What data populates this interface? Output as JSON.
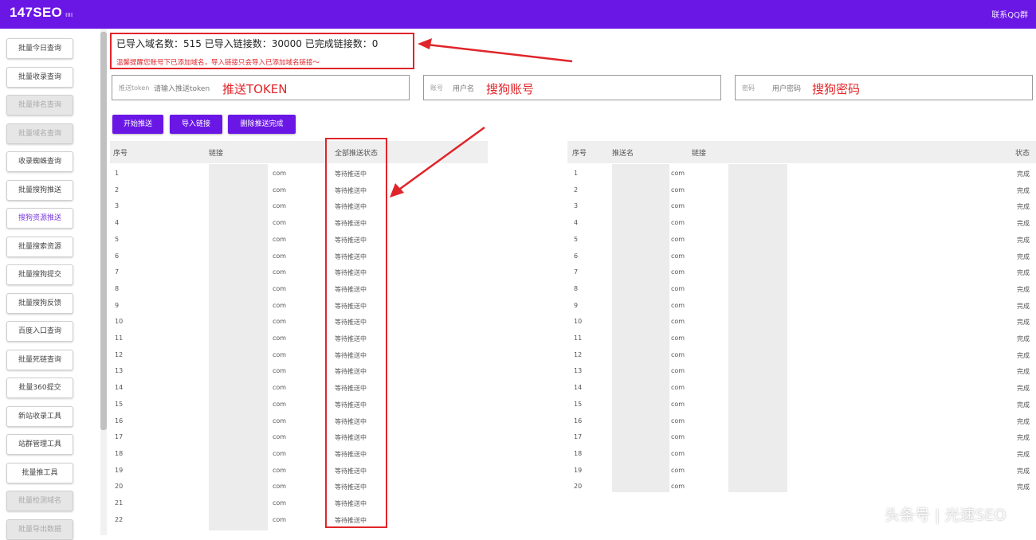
{
  "header": {
    "brand": "147SEO",
    "brand_sub": "ιιιι",
    "contact": "联系QQ群"
  },
  "sidebar": {
    "items": [
      {
        "label": "批量今日查询",
        "state": "normal"
      },
      {
        "label": "批量收录查询",
        "state": "normal"
      },
      {
        "label": "批量排名查询",
        "state": "disabled"
      },
      {
        "label": "批量域名查询",
        "state": "disabled"
      },
      {
        "label": "收录蜘蛛查询",
        "state": "normal"
      },
      {
        "label": "批量搜狗推送",
        "state": "normal"
      },
      {
        "label": "搜狗资源推送",
        "state": "active"
      },
      {
        "label": "批量搜索资源",
        "state": "normal"
      },
      {
        "label": "批量搜狗提交",
        "state": "normal"
      },
      {
        "label": "批量搜狗反馈",
        "state": "normal"
      },
      {
        "label": "百度入口查询",
        "state": "normal"
      },
      {
        "label": "批量死链查询",
        "state": "normal"
      },
      {
        "label": "批量360提交",
        "state": "normal"
      },
      {
        "label": "新站收录工具",
        "state": "normal"
      },
      {
        "label": "站群管理工具",
        "state": "normal"
      },
      {
        "label": "批量推工具",
        "state": "normal"
      },
      {
        "label": "批量检测域名",
        "state": "disabled"
      },
      {
        "label": "批量导出数据",
        "state": "disabled"
      }
    ]
  },
  "stats": {
    "line": "已导入域名数：515 已导入链接数：30000 已完成链接数：0",
    "warning": "温馨提醒您账号下已添加域名，导入链接只会导入已添加域名链接～"
  },
  "fields": [
    {
      "label": "推送token",
      "placeholder": "请输入推送token",
      "annotation": "推送TOKEN"
    },
    {
      "label": "账号",
      "placeholder": "用户名",
      "annotation": "搜狗账号"
    },
    {
      "label": "密码",
      "placeholder": "用户密码",
      "annotation": "搜狗密码"
    }
  ],
  "buttons": [
    "开始推送",
    "导入链接",
    "删除推送完成"
  ],
  "left_table": {
    "headers": [
      "序号",
      "链接",
      "全部推送状态"
    ],
    "rows": [
      {
        "idx": "1",
        "link": "com",
        "status": "等待推送中"
      },
      {
        "idx": "2",
        "link": "com",
        "status": "等待推送中"
      },
      {
        "idx": "3",
        "link": "com",
        "status": "等待推送中"
      },
      {
        "idx": "4",
        "link": "com",
        "status": "等待推送中"
      },
      {
        "idx": "5",
        "link": "com",
        "status": "等待推送中"
      },
      {
        "idx": "6",
        "link": "com",
        "status": "等待推送中"
      },
      {
        "idx": "7",
        "link": "com",
        "status": "等待推送中"
      },
      {
        "idx": "8",
        "link": "com",
        "status": "等待推送中"
      },
      {
        "idx": "9",
        "link": "com",
        "status": "等待推送中"
      },
      {
        "idx": "10",
        "link": "com",
        "status": "等待推送中"
      },
      {
        "idx": "11",
        "link": "com",
        "status": "等待推送中"
      },
      {
        "idx": "12",
        "link": "com",
        "status": "等待推送中"
      },
      {
        "idx": "13",
        "link": "com",
        "status": "等待推送中"
      },
      {
        "idx": "14",
        "link": "com",
        "status": "等待推送中"
      },
      {
        "idx": "15",
        "link": "com",
        "status": "等待推送中"
      },
      {
        "idx": "16",
        "link": "com",
        "status": "等待推送中"
      },
      {
        "idx": "17",
        "link": "com",
        "status": "等待推送中"
      },
      {
        "idx": "18",
        "link": "com",
        "status": "等待推送中"
      },
      {
        "idx": "19",
        "link": "com",
        "status": "等待推送中"
      },
      {
        "idx": "20",
        "link": "com",
        "status": "等待推送中"
      },
      {
        "idx": "21",
        "link": "com",
        "status": "等待推送中"
      },
      {
        "idx": "22",
        "link": "com",
        "status": "等待推送中"
      }
    ]
  },
  "right_table": {
    "headers": [
      "序号",
      "推送名",
      "链接",
      "状态"
    ],
    "rows": [
      {
        "idx": "1",
        "name": "",
        "link": "com",
        "status": "完成"
      },
      {
        "idx": "2",
        "name": "",
        "link": "com",
        "status": "完成"
      },
      {
        "idx": "3",
        "name": "",
        "link": "com",
        "status": "完成"
      },
      {
        "idx": "4",
        "name": "",
        "link": "com",
        "status": "完成"
      },
      {
        "idx": "5",
        "name": "",
        "link": "com",
        "status": "完成"
      },
      {
        "idx": "6",
        "name": "",
        "link": "com",
        "status": "完成"
      },
      {
        "idx": "7",
        "name": "",
        "link": "com",
        "status": "完成"
      },
      {
        "idx": "8",
        "name": "",
        "link": "com",
        "status": "完成"
      },
      {
        "idx": "9",
        "name": "",
        "link": "com",
        "status": "完成"
      },
      {
        "idx": "10",
        "name": "",
        "link": "com",
        "status": "完成"
      },
      {
        "idx": "11",
        "name": "",
        "link": "com",
        "status": "完成"
      },
      {
        "idx": "12",
        "name": "",
        "link": "com",
        "status": "完成"
      },
      {
        "idx": "13",
        "name": "",
        "link": "com",
        "status": "完成"
      },
      {
        "idx": "14",
        "name": "",
        "link": "com",
        "status": "完成"
      },
      {
        "idx": "15",
        "name": "",
        "link": "com",
        "status": "完成"
      },
      {
        "idx": "16",
        "name": "",
        "link": "com",
        "status": "完成"
      },
      {
        "idx": "17",
        "name": "",
        "link": "com",
        "status": "完成"
      },
      {
        "idx": "18",
        "name": "",
        "link": "com",
        "status": "完成"
      },
      {
        "idx": "19",
        "name": "",
        "link": "com",
        "status": "完成"
      },
      {
        "idx": "20",
        "name": "",
        "link": "com",
        "status": "完成"
      }
    ]
  },
  "watermark": "头条号 | 光速SEO",
  "colors": {
    "accent": "#6a17e6",
    "annotation_red": "#e0252a"
  }
}
